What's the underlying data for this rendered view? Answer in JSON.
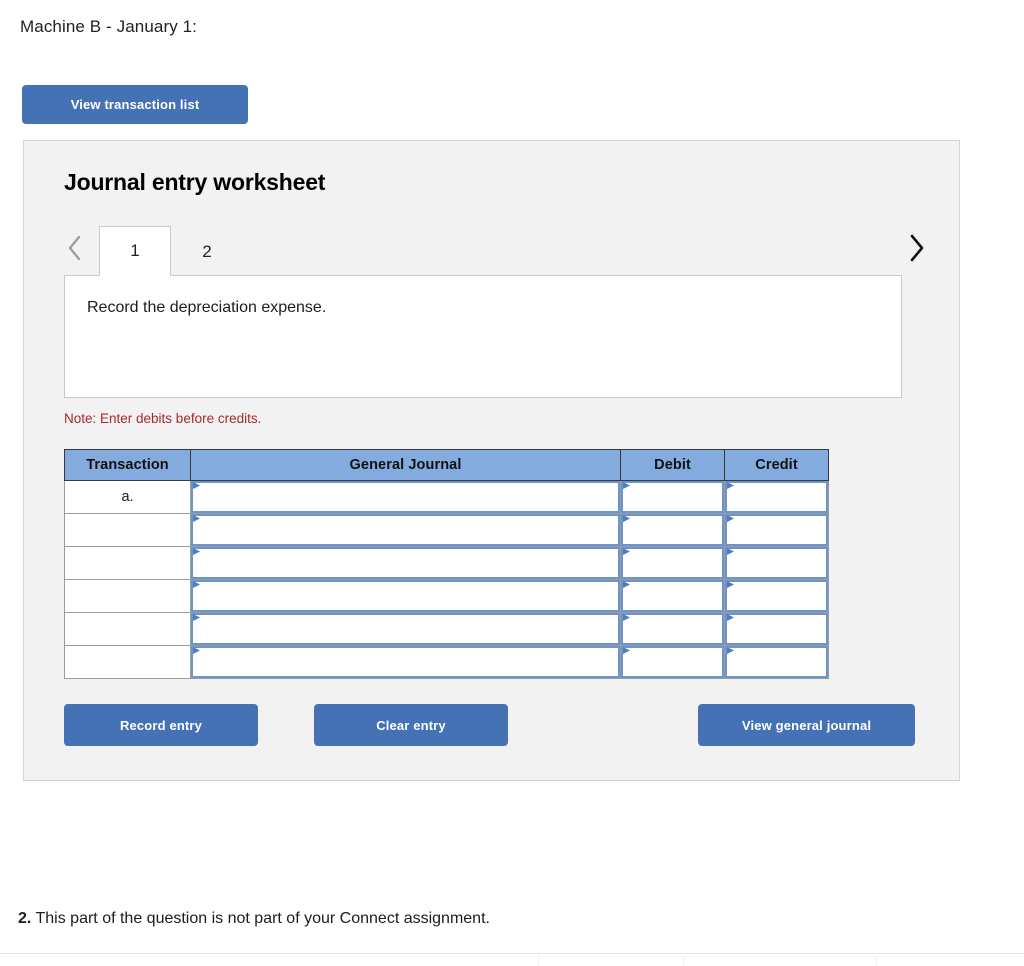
{
  "page": {
    "heading": "Machine B - January 1:"
  },
  "toolbar": {
    "view_transaction_list_label": "View transaction list"
  },
  "worksheet": {
    "title": "Journal entry worksheet",
    "prev_icon": "chevron-left-icon",
    "next_icon": "chevron-right-icon",
    "tabs": [
      {
        "label": "1",
        "active": true
      },
      {
        "label": "2",
        "active": false
      }
    ],
    "description": "Record the depreciation expense.",
    "note": "Note: Enter debits before credits.",
    "table": {
      "headers": [
        "Transaction",
        "General Journal",
        "Debit",
        "Credit"
      ],
      "rows": [
        {
          "transaction": "a.",
          "general_journal": "",
          "debit": "",
          "credit": ""
        },
        {
          "transaction": "",
          "general_journal": "",
          "debit": "",
          "credit": ""
        },
        {
          "transaction": "",
          "general_journal": "",
          "debit": "",
          "credit": ""
        },
        {
          "transaction": "",
          "general_journal": "",
          "debit": "",
          "credit": ""
        },
        {
          "transaction": "",
          "general_journal": "",
          "debit": "",
          "credit": ""
        },
        {
          "transaction": "",
          "general_journal": "",
          "debit": "",
          "credit": ""
        }
      ]
    },
    "actions": {
      "record_entry_label": "Record entry",
      "clear_entry_label": "Clear entry",
      "view_general_journal_label": "View general journal"
    }
  },
  "footer": {
    "question_number": "2.",
    "question_text": "This part of the question is not part of your Connect assignment."
  },
  "colors": {
    "button_blue": "#4472b4",
    "table_header_blue": "#84abde",
    "field_border_blue": "#6c96cb",
    "note_red": "#a52b2b",
    "panel_background": "#f2f2f2"
  }
}
